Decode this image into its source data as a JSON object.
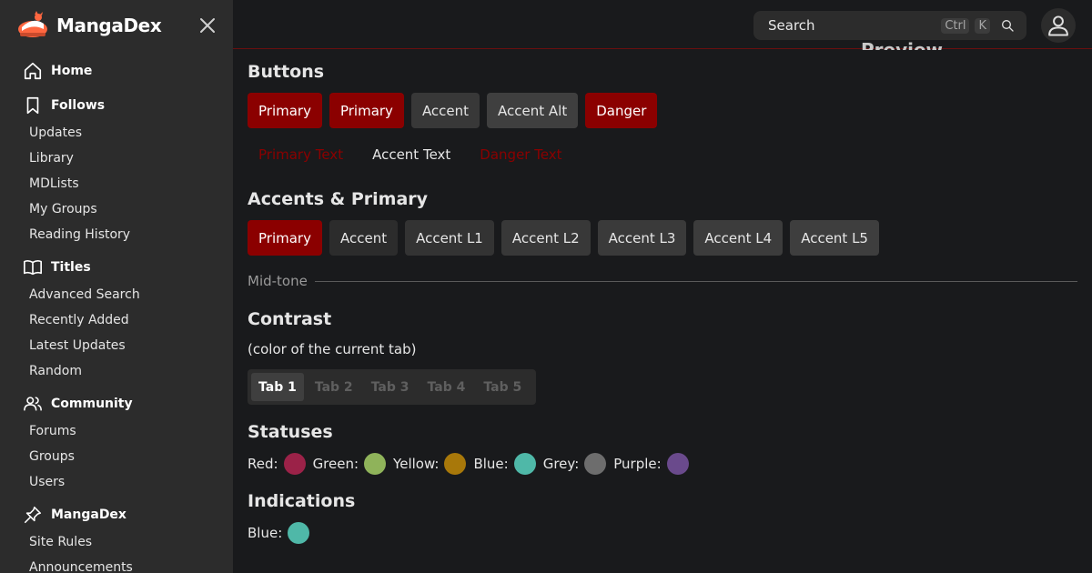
{
  "app": {
    "brand_name": "MangaDex"
  },
  "sidebar": {
    "sections": [
      {
        "label": "Home",
        "icon": "home-icon",
        "items": []
      },
      {
        "label": "Follows",
        "icon": "bookmark-icon",
        "items": [
          "Updates",
          "Library",
          "MDLists",
          "My Groups",
          "Reading History"
        ]
      },
      {
        "label": "Titles",
        "icon": "book-open-icon",
        "items": [
          "Advanced Search",
          "Recently Added",
          "Latest Updates",
          "Random"
        ]
      },
      {
        "label": "Community",
        "icon": "users-icon",
        "items": [
          "Forums",
          "Groups",
          "Users"
        ]
      },
      {
        "label": "MangaDex",
        "icon": "pin-icon",
        "items": [
          "Site Rules",
          "Announcements"
        ]
      }
    ]
  },
  "header": {
    "search_placeholder": "Search",
    "shortcut_ctrl": "Ctrl",
    "shortcut_k": "K",
    "preview_title": "Preview"
  },
  "main": {
    "buttons": {
      "title": "Buttons",
      "filled": [
        {
          "label": "Primary",
          "kind": "primary"
        },
        {
          "label": "Primary",
          "kind": "primary"
        },
        {
          "label": "Accent",
          "kind": "accent"
        },
        {
          "label": "Accent Alt",
          "kind": "accent-alt"
        },
        {
          "label": "Danger",
          "kind": "danger"
        }
      ],
      "text": [
        {
          "label": "Primary Text",
          "kind": "primary"
        },
        {
          "label": "Accent Text",
          "kind": "accent"
        },
        {
          "label": "Danger Text",
          "kind": "danger"
        }
      ]
    },
    "accents": {
      "title": "Accents & Primary",
      "items": [
        {
          "label": "Primary",
          "kind": "primary"
        },
        {
          "label": "Accent",
          "kind": "accent"
        },
        {
          "label": "Accent L1",
          "kind": "l1"
        },
        {
          "label": "Accent L2",
          "kind": "l2"
        },
        {
          "label": "Accent L3",
          "kind": "l3"
        },
        {
          "label": "Accent L4",
          "kind": "l4"
        },
        {
          "label": "Accent L5",
          "kind": "l5"
        }
      ]
    },
    "midtone_label": "Mid-tone",
    "contrast": {
      "title": "Contrast",
      "subtitle": "(color of the current tab)",
      "tabs": [
        "Tab 1",
        "Tab 2",
        "Tab 3",
        "Tab 4",
        "Tab 5"
      ],
      "active_tab": 0
    },
    "statuses": {
      "title": "Statuses",
      "items": [
        {
          "label": "Red:",
          "color": "#9b2248"
        },
        {
          "label": "Green:",
          "color": "#8fb35a"
        },
        {
          "label": "Yellow:",
          "color": "#a8780a"
        },
        {
          "label": "Blue:",
          "color": "#4fb8a8"
        },
        {
          "label": "Grey:",
          "color": "#6d6d6d"
        },
        {
          "label": "Purple:",
          "color": "#6a4a8c"
        }
      ]
    },
    "indications": {
      "title": "Indications",
      "items": [
        {
          "label": "Blue:",
          "color": "#4fb8a8"
        }
      ]
    }
  }
}
